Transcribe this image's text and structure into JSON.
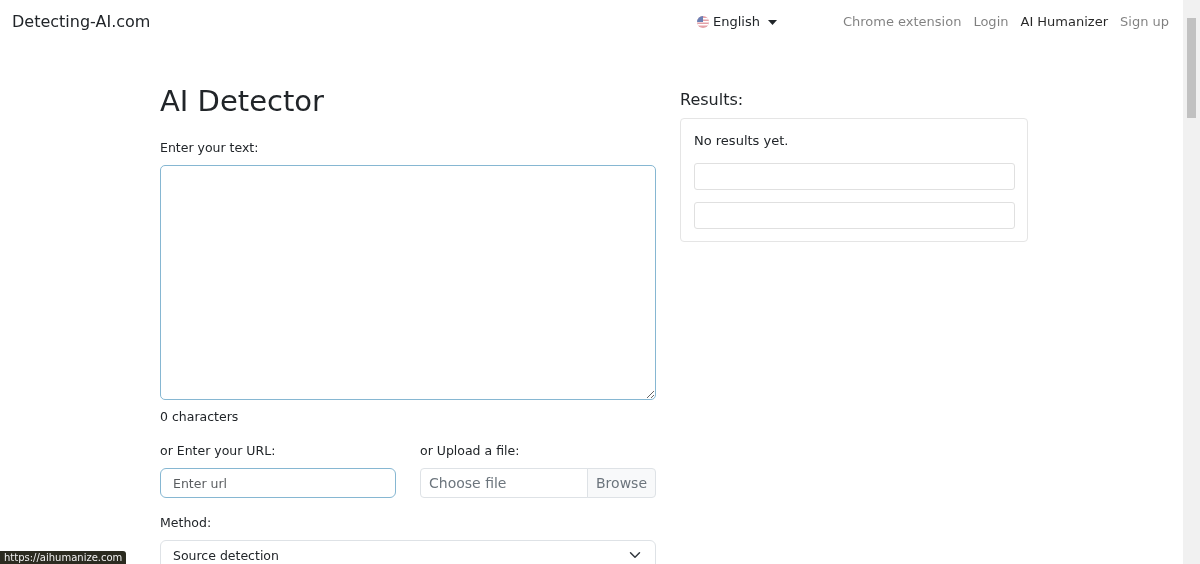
{
  "navbar": {
    "brand": "Detecting-AI.com",
    "language": "English",
    "links": [
      {
        "label": "Chrome extension",
        "active": false
      },
      {
        "label": "Login",
        "active": false
      },
      {
        "label": "AI Humanizer",
        "active": true
      },
      {
        "label": "Sign up",
        "active": false
      }
    ]
  },
  "title": "AI Detector",
  "text_input": {
    "label": "Enter your text:",
    "counter": "0 characters"
  },
  "url_input": {
    "label": "or Enter your URL:",
    "placeholder": "Enter url"
  },
  "file_input": {
    "label": "or Upload a file:",
    "placeholder": "Choose file",
    "button": "Browse"
  },
  "method": {
    "label": "Method:",
    "value": "Source detection"
  },
  "results": {
    "heading": "Results:",
    "message": "No results yet."
  },
  "status_bar": "https://aihumanize.com"
}
